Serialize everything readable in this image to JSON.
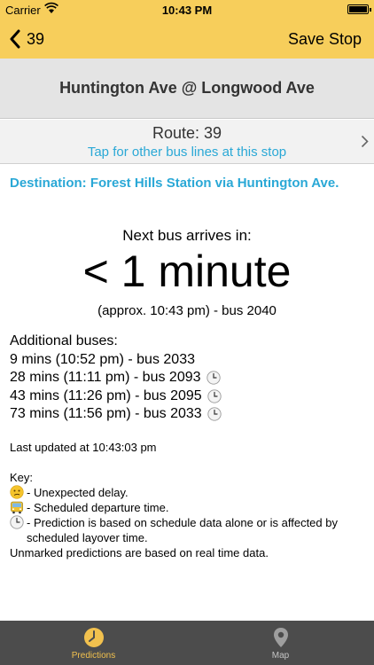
{
  "status_bar": {
    "carrier": "Carrier",
    "time": "10:43 PM"
  },
  "nav": {
    "back_label": "39",
    "save_label": "Save Stop"
  },
  "stop": {
    "name": "Huntington Ave @ Longwood Ave"
  },
  "route": {
    "label": "Route: 39",
    "hint": "Tap for other bus lines at this stop"
  },
  "destination": "Destination: Forest Hills Station via Huntington Ave.",
  "next_bus": {
    "label": "Next bus arrives in:",
    "time": "< 1 minute",
    "detail": "(approx. 10:43 pm) - bus 2040"
  },
  "additional": {
    "title": "Additional buses:",
    "buses": [
      {
        "text": "9 mins (10:52 pm) - bus 2033",
        "scheduled": false
      },
      {
        "text": "28 mins (11:11 pm) - bus 2093",
        "scheduled": true
      },
      {
        "text": "43 mins (11:26 pm) - bus 2095",
        "scheduled": true
      },
      {
        "text": "73 mins (11:56 pm) - bus 2033",
        "scheduled": true
      }
    ]
  },
  "last_updated": "Last updated at 10:43:03 pm",
  "key": {
    "title": "Key:",
    "delay": "- Unexpected delay.",
    "departure": "- Scheduled departure time.",
    "schedule": "- Prediction is based on schedule data alone or is affected by scheduled layover time.",
    "note": "Unmarked predictions are based on real time data."
  },
  "tabs": {
    "predictions": "Predictions",
    "map": "Map"
  },
  "colors": {
    "accent_yellow": "#f7ce5b",
    "link_blue": "#2aa8d6",
    "tabbar_bg": "#4c4c4c",
    "tab_active": "#f2c14e",
    "tab_inactive": "#c4c4c4"
  },
  "icons": {
    "back": "chevron-left-icon",
    "route_more": "chevron-right-icon",
    "scheduled": "clock-icon",
    "delay": "confused-face-icon",
    "departure": "bus-icon",
    "predictions_tab": "clock-tab-icon",
    "map_tab": "map-pin-icon"
  }
}
